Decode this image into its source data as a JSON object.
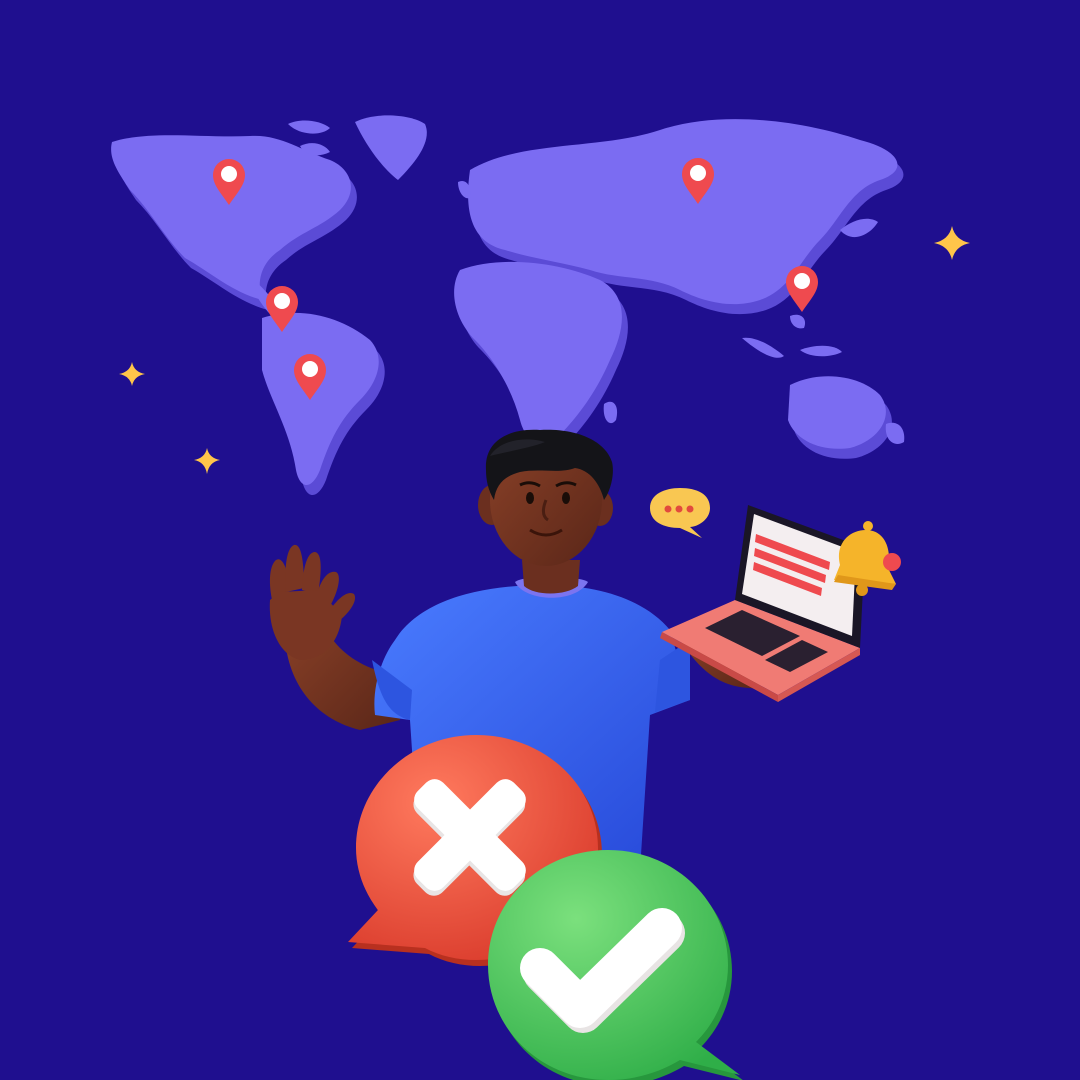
{
  "scene": {
    "background_color": "#1f0f8f",
    "map_color": "#7b6cf2",
    "map_shadow_color": "#5b4bd6",
    "pin_color": "#ef4a4f",
    "sparkle_color": "#ffc54a",
    "shirt_color": "#3566f0",
    "skin_color": "#6b2f1f",
    "laptop_color": "#f07b74",
    "reject_bubble_color": "#e9503b",
    "approve_bubble_color": "#47c75c",
    "pins": [
      "north-america",
      "central-america",
      "south-america",
      "asia-north",
      "asia-east"
    ],
    "icons": [
      "map-pin-icon",
      "sparkle-icon",
      "speech-bubble-icon",
      "bell-icon",
      "close-icon",
      "check-icon"
    ]
  }
}
